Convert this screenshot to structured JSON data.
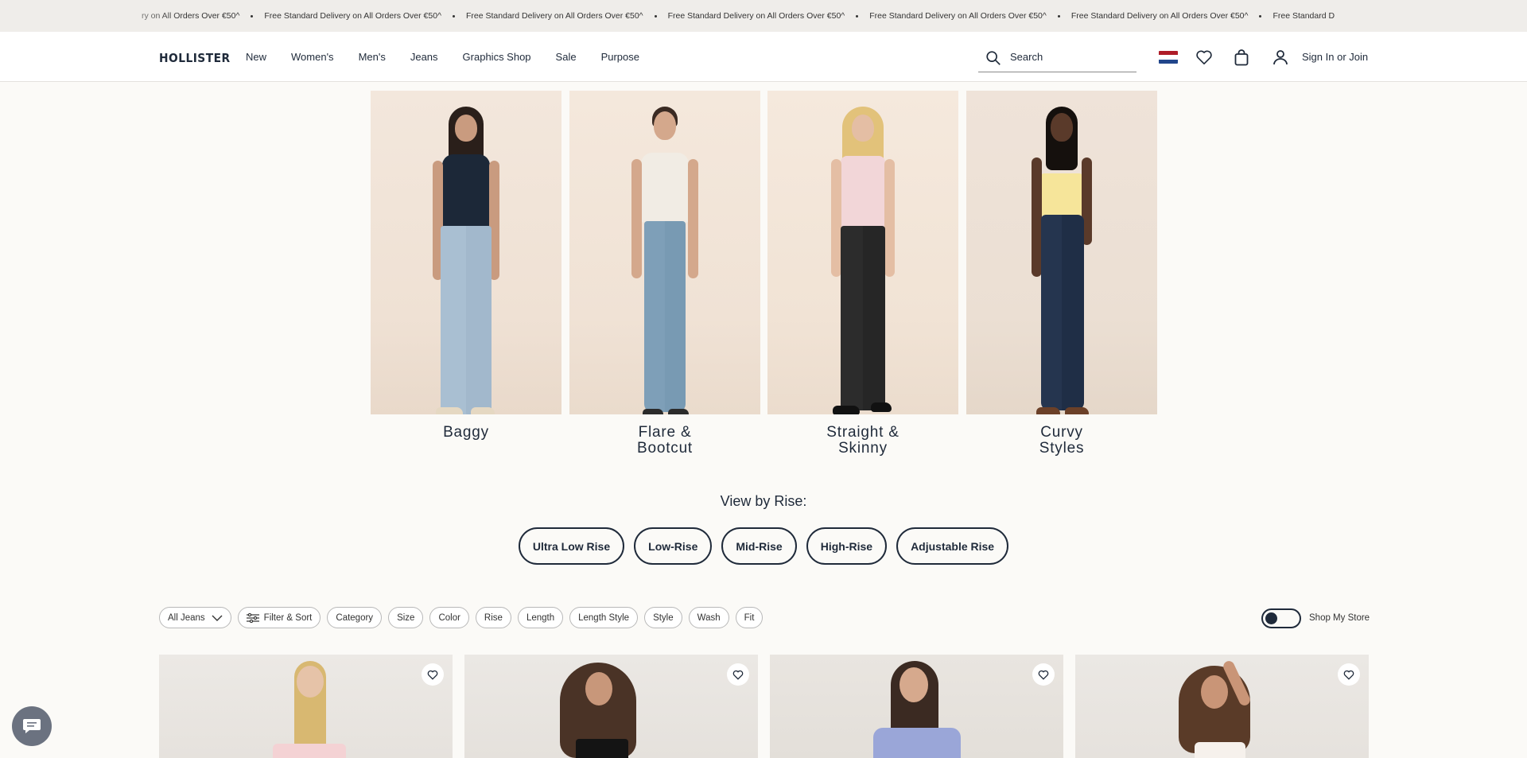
{
  "promo": {
    "items": [
      "ry on All Orders Over €50^",
      "Free Standard Delivery on All Orders Over €50^",
      "Free Standard Delivery on All Orders Over €50^",
      "Free Standard Delivery on All Orders Over €50^",
      "Free Standard Delivery on All Orders Over €50^",
      "Free Standard Delivery on All Orders Over €50^",
      "Free Standard D"
    ]
  },
  "header": {
    "logo": "HOLLISTER",
    "nav": [
      "New",
      "Women's",
      "Men's",
      "Jeans",
      "Graphics Shop",
      "Sale",
      "Purpose"
    ],
    "search_placeholder": "Search",
    "sign_in": "Sign In or Join",
    "flag_colors": [
      "#ae1c28",
      "#ffffff",
      "#21468b"
    ]
  },
  "categories": [
    {
      "label": "Baggy",
      "image": "model-light-wash-baggy-jeans"
    },
    {
      "label": "Flare &\nBootcut",
      "image": "model-light-wash-flare-jeans"
    },
    {
      "label": "Straight &\nSkinny",
      "image": "model-black-straight-jeans"
    },
    {
      "label": "Curvy\nStyles",
      "image": "model-dark-wash-curvy-flare-jeans"
    }
  ],
  "rise": {
    "title": "View by Rise:",
    "options": [
      "Ultra Low Rise",
      "Low-Rise",
      "Mid-Rise",
      "High-Rise",
      "Adjustable Rise"
    ]
  },
  "filters": {
    "all_jeans": "All Jeans",
    "filter_sort": "Filter & Sort",
    "chips": [
      "Category",
      "Size",
      "Color",
      "Rise",
      "Length",
      "Length Style",
      "Style",
      "Wash",
      "Fit"
    ],
    "shop_my_store": "Shop My Store",
    "shop_my_store_on": false
  },
  "products": [
    {
      "image": "model-pink-tube-top"
    },
    {
      "image": "model-black-polka-dot-cami"
    },
    {
      "image": "model-blue-button-shirt"
    },
    {
      "image": "model-white-lace-top"
    }
  ],
  "colors": {
    "brand_navy": "#1f2a3a",
    "background": "#fbfaf7"
  }
}
